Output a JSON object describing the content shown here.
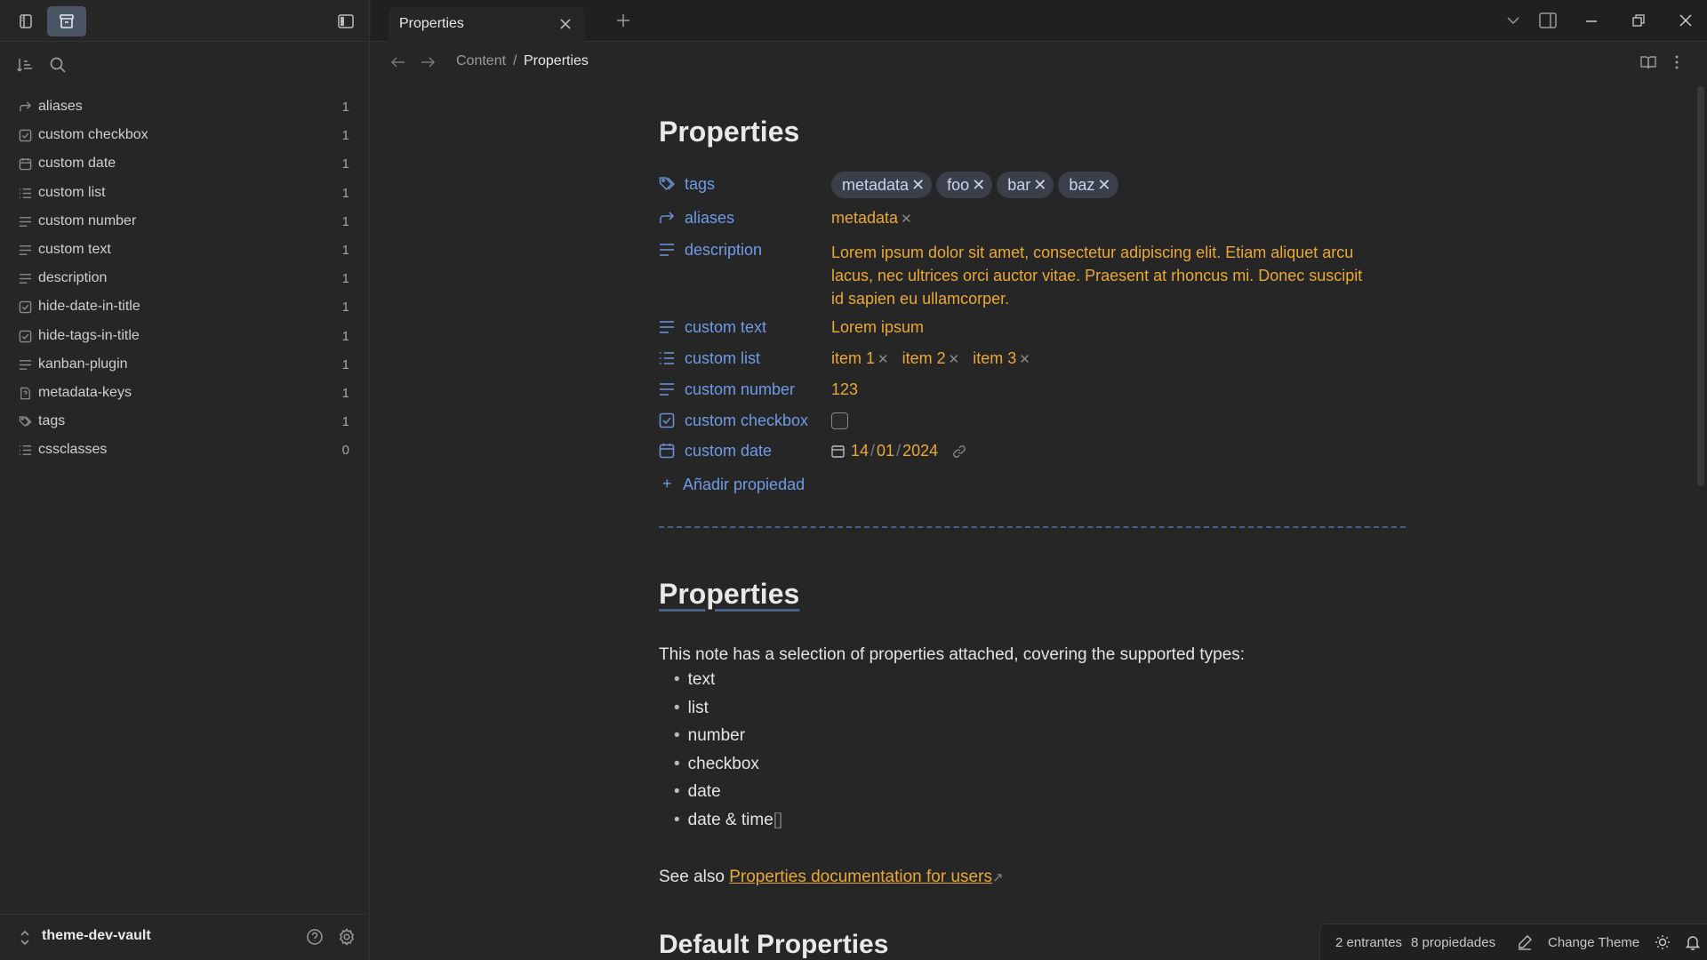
{
  "sidebar": {
    "items": [
      {
        "label": "aliases",
        "count": "1",
        "icon": "alias-arrow-icon"
      },
      {
        "label": "custom checkbox",
        "count": "1",
        "icon": "checkbox-icon"
      },
      {
        "label": "custom date",
        "count": "1",
        "icon": "calendar-icon"
      },
      {
        "label": "custom list",
        "count": "1",
        "icon": "list-icon"
      },
      {
        "label": "custom number",
        "count": "1",
        "icon": "text-lines-icon"
      },
      {
        "label": "custom text",
        "count": "1",
        "icon": "text-lines-icon"
      },
      {
        "label": "description",
        "count": "1",
        "icon": "text-lines-icon"
      },
      {
        "label": "hide-date-in-title",
        "count": "1",
        "icon": "checkbox-icon"
      },
      {
        "label": "hide-tags-in-title",
        "count": "1",
        "icon": "checkbox-icon"
      },
      {
        "label": "kanban-plugin",
        "count": "1",
        "icon": "text-lines-icon"
      },
      {
        "label": "metadata-keys",
        "count": "1",
        "icon": "unknown-file-icon"
      },
      {
        "label": "tags",
        "count": "1",
        "icon": "tags-icon"
      },
      {
        "label": "cssclasses",
        "count": "0",
        "icon": "list-icon"
      }
    ],
    "vault_name": "theme-dev-vault"
  },
  "tabbar": {
    "tab_title": "Properties"
  },
  "breadcrumb": {
    "parent": "Content",
    "separator": "/",
    "current": "Properties"
  },
  "doc": {
    "title": "Properties",
    "properties": {
      "tags": {
        "key": "tags",
        "values": [
          "metadata",
          "foo",
          "bar",
          "baz"
        ]
      },
      "aliases": {
        "key": "aliases",
        "value": "metadata"
      },
      "description": {
        "key": "description",
        "line1": "Lorem ipsum dolor sit amet, consectetur adipiscing elit. Etiam aliquet arcu",
        "line2": "lacus, nec ultrices orci auctor vitae. Praesent at rhoncus mi. Donec suscipit",
        "line3": "id sapien eu ullamcorper."
      },
      "custom_text": {
        "key": "custom text",
        "value": "Lorem ipsum"
      },
      "custom_list": {
        "key": "custom list",
        "values": [
          "item 1",
          "item 2",
          "item 3"
        ]
      },
      "custom_number": {
        "key": "custom number",
        "value": "123"
      },
      "custom_checkbox": {
        "key": "custom checkbox",
        "checked": false
      },
      "custom_date": {
        "key": "custom date",
        "day": "14",
        "month": "01",
        "year": "2024"
      },
      "add_label": "Añadir propiedad"
    },
    "heading2": "Properties",
    "intro": "This note has a selection of properties attached, covering the supported types:",
    "bullets": [
      "text",
      "list",
      "number",
      "checkbox",
      "date",
      "date & time"
    ],
    "bullet_suffix": "[]",
    "see_also_prefix": "See also ",
    "see_also_link": "Properties documentation for users",
    "heading3": "Default Properties"
  },
  "status": {
    "entries": "2 entrantes",
    "props": "8 propiedades",
    "theme": "Change Theme"
  },
  "colors": {
    "accent": "#6f9be6",
    "value": "#e9a83a",
    "background": "#262626"
  }
}
